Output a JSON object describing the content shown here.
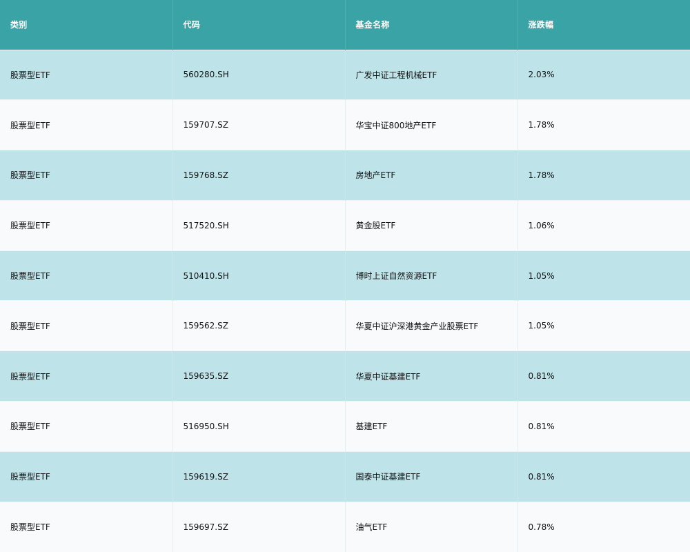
{
  "table": {
    "headers": [
      "类别",
      "代码",
      "基金名称",
      "涨跌幅"
    ],
    "rows": [
      [
        "股票型ETF",
        "560280.SH",
        "广发中证工程机械ETF",
        "2.03%"
      ],
      [
        "股票型ETF",
        "159707.SZ",
        "华宝中证800地产ETF",
        "1.78%"
      ],
      [
        "股票型ETF",
        "159768.SZ",
        "房地产ETF",
        "1.78%"
      ],
      [
        "股票型ETF",
        "517520.SH",
        "黄金股ETF",
        "1.06%"
      ],
      [
        "股票型ETF",
        "510410.SH",
        "博时上证自然资源ETF",
        "1.05%"
      ],
      [
        "股票型ETF",
        "159562.SZ",
        "华夏中证沪深港黄金产业股票ETF",
        "1.05%"
      ],
      [
        "股票型ETF",
        "159635.SZ",
        "华夏中证基建ETF",
        "0.81%"
      ],
      [
        "股票型ETF",
        "516950.SH",
        "基建ETF",
        "0.81%"
      ],
      [
        "股票型ETF",
        "159619.SZ",
        "国泰中证基建ETF",
        "0.81%"
      ],
      [
        "股票型ETF",
        "159697.SZ",
        "油气ETF",
        "0.78%"
      ]
    ]
  },
  "colors": {
    "header_bg": "#3aa3a5",
    "row_alt_bg": "#bee4ea",
    "row_bg": "#f8fafc"
  }
}
